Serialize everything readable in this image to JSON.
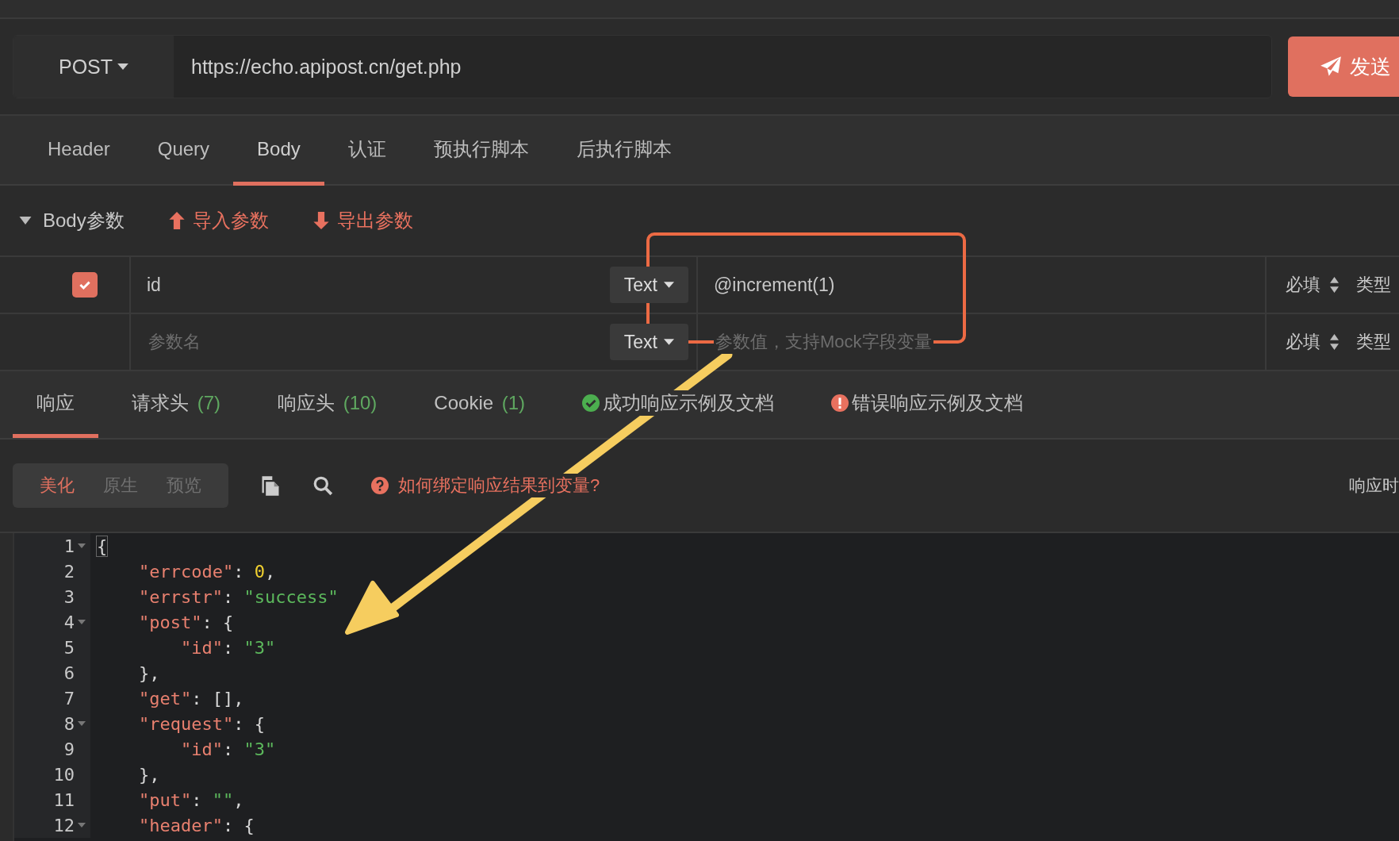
{
  "request": {
    "method": "POST",
    "url": "https://echo.apipost.cn/get.php",
    "send_button": "发送"
  },
  "request_tabs": [
    {
      "label": "Header",
      "selected": false
    },
    {
      "label": "Query",
      "selected": false
    },
    {
      "label": "Body",
      "selected": true
    },
    {
      "label": "认证",
      "selected": false
    },
    {
      "label": "预执行脚本",
      "selected": false
    },
    {
      "label": "后执行脚本",
      "selected": false
    }
  ],
  "body_section": {
    "title": "Body参数",
    "expanded": true,
    "import_link": "导入参数",
    "export_link": "导出参数"
  },
  "params": [
    {
      "checked": true,
      "name": "id",
      "name_placeholder": false,
      "type": "Text",
      "value": "@increment(1)",
      "value_placeholder": false,
      "required": "必填",
      "column_5": "类型"
    },
    {
      "checked": false,
      "name": "参数名",
      "name_placeholder": true,
      "type": "Text",
      "value": "参数值，支持Mock字段变量",
      "value_placeholder": true,
      "required": "必填",
      "column_5": "类型"
    }
  ],
  "response_tabs": [
    {
      "kind": "plain",
      "label": "响应",
      "selected": true
    },
    {
      "kind": "plain",
      "label": "请求头",
      "count": "(7)",
      "selected": false
    },
    {
      "kind": "plain",
      "label": "响应头",
      "count": "(10)",
      "selected": false
    },
    {
      "kind": "plain",
      "label": "Cookie",
      "count": "(1)",
      "selected": false
    },
    {
      "kind": "success",
      "label": "成功响应示例及文档",
      "selected": false
    },
    {
      "kind": "error",
      "label": "错误响应示例及文档",
      "selected": false
    }
  ],
  "view_modes": [
    {
      "label": "美化",
      "selected": true
    },
    {
      "label": "原生",
      "selected": false
    },
    {
      "label": "预览",
      "selected": false
    }
  ],
  "help_link": "如何绑定响应结果到变量?",
  "response_time_label": "响应时",
  "code_lines": [
    {
      "number": "1",
      "foldable": true,
      "tokens": [
        {
          "kind": "brace",
          "text": "{"
        }
      ]
    },
    {
      "number": "2",
      "foldable": false,
      "tokens": [
        {
          "kind": "key",
          "text": "    \"errcode\""
        },
        {
          "kind": "punct",
          "text": ": "
        },
        {
          "kind": "number",
          "text": "0"
        },
        {
          "kind": "punct",
          "text": ","
        }
      ]
    },
    {
      "number": "3",
      "foldable": false,
      "tokens": [
        {
          "kind": "key",
          "text": "    \"errstr\""
        },
        {
          "kind": "punct",
          "text": ": "
        },
        {
          "kind": "string",
          "text": "\"success\""
        }
      ]
    },
    {
      "number": "4",
      "foldable": true,
      "tokens": [
        {
          "kind": "key",
          "text": "    \"post\""
        },
        {
          "kind": "punct",
          "text": ": {"
        }
      ]
    },
    {
      "number": "5",
      "foldable": false,
      "tokens": [
        {
          "kind": "key",
          "text": "        \"id\""
        },
        {
          "kind": "punct",
          "text": ": "
        },
        {
          "kind": "string",
          "text": "\"3\""
        }
      ]
    },
    {
      "number": "6",
      "foldable": false,
      "tokens": [
        {
          "kind": "punct",
          "text": "    },"
        }
      ]
    },
    {
      "number": "7",
      "foldable": false,
      "tokens": [
        {
          "kind": "key",
          "text": "    \"get\""
        },
        {
          "kind": "punct",
          "text": ": [],"
        }
      ]
    },
    {
      "number": "8",
      "foldable": true,
      "tokens": [
        {
          "kind": "key",
          "text": "    \"request\""
        },
        {
          "kind": "punct",
          "text": ": {"
        }
      ]
    },
    {
      "number": "9",
      "foldable": false,
      "tokens": [
        {
          "kind": "key",
          "text": "        \"id\""
        },
        {
          "kind": "punct",
          "text": ": "
        },
        {
          "kind": "string",
          "text": "\"3\""
        }
      ]
    },
    {
      "number": "10",
      "foldable": false,
      "tokens": [
        {
          "kind": "punct",
          "text": "    },"
        }
      ]
    },
    {
      "number": "11",
      "foldable": false,
      "tokens": [
        {
          "kind": "key",
          "text": "    \"put\""
        },
        {
          "kind": "punct",
          "text": ": "
        },
        {
          "kind": "string",
          "text": "\"\""
        },
        {
          "kind": "punct",
          "text": ","
        }
      ]
    },
    {
      "number": "12",
      "foldable": true,
      "tokens": [
        {
          "kind": "key",
          "text": "    \"header\""
        },
        {
          "kind": "punct",
          "text": ": {"
        }
      ]
    }
  ]
}
